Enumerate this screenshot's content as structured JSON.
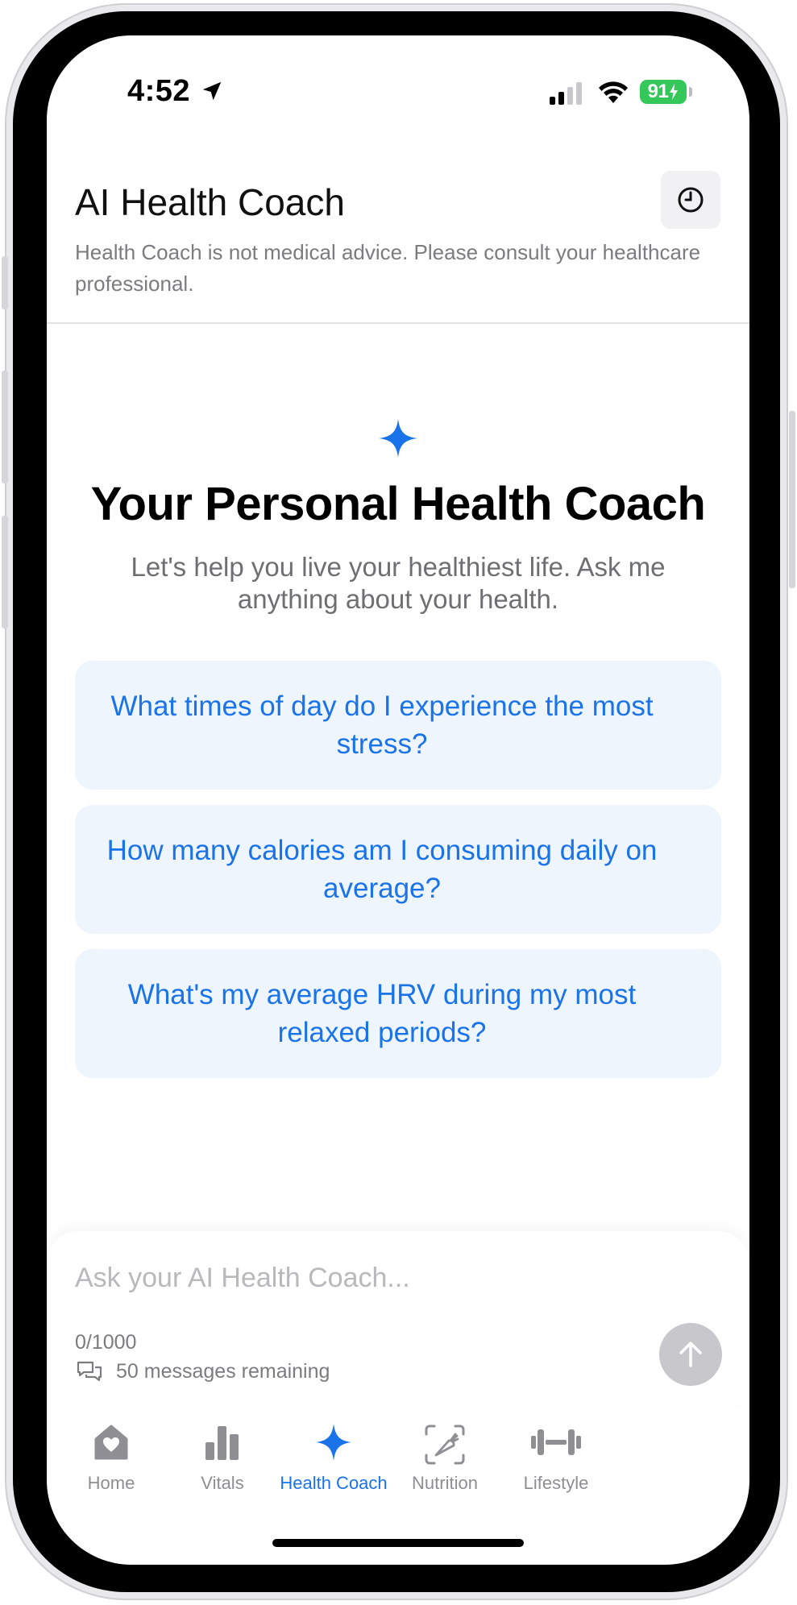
{
  "status_bar": {
    "time": "4:52",
    "battery": "91",
    "battery_color": "#34c759"
  },
  "header": {
    "title": "AI Health Coach",
    "disclaimer": "Health Coach is not medical advice. Please consult your healthcare professional.",
    "history_icon": "clock-icon"
  },
  "hero": {
    "icon": "sparkle-icon",
    "title": "Your Personal Health Coach",
    "subtitle": "Let's help you live your healthiest life. Ask me anything about your health."
  },
  "suggestions": [
    "What times of day do I experience the most stress?",
    "How many calories am I consuming daily on average?",
    "What's my average HRV during my most relaxed periods?"
  ],
  "composer": {
    "placeholder": "Ask your AI Health Coach...",
    "value": "",
    "char_count": "0/1000",
    "messages_remaining": "50 messages remaining",
    "send_icon": "arrow-up-icon"
  },
  "tabs": [
    {
      "label": "Home",
      "icon": "house-heart-icon",
      "active": false
    },
    {
      "label": "Vitals",
      "icon": "bar-chart-icon",
      "active": false
    },
    {
      "label": "Health Coach",
      "icon": "sparkle-icon",
      "active": true
    },
    {
      "label": "Nutrition",
      "icon": "carrot-icon",
      "active": false
    },
    {
      "label": "Lifestyle",
      "icon": "dumbbell-icon",
      "active": false
    }
  ],
  "colors": {
    "accent": "#1a73e8",
    "suggestion_bg": "#eef5fd",
    "muted_text": "#7b7b80",
    "inactive_tab": "#8e8e93"
  }
}
